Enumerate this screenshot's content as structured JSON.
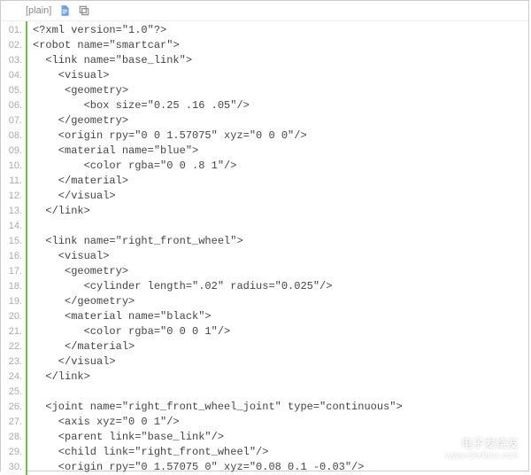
{
  "header": {
    "label": "[plain]",
    "icon1": "document-icon",
    "icon2": "copy-icon"
  },
  "lines": [
    {
      "n": "01.",
      "text": "<?xml version=\"1.0\"?>"
    },
    {
      "n": "02.",
      "text": "<robot name=\"smartcar\">"
    },
    {
      "n": "03.",
      "text": "  <link name=\"base_link\">"
    },
    {
      "n": "04.",
      "text": "    <visual>"
    },
    {
      "n": "05.",
      "text": "     <geometry>"
    },
    {
      "n": "06.",
      "text": "        <box size=\"0.25 .16 .05\"/>"
    },
    {
      "n": "07.",
      "text": "    </geometry>"
    },
    {
      "n": "08.",
      "text": "    <origin rpy=\"0 0 1.57075\" xyz=\"0 0 0\"/>"
    },
    {
      "n": "09.",
      "text": "    <material name=\"blue\">"
    },
    {
      "n": "10.",
      "text": "        <color rgba=\"0 0 .8 1\"/>"
    },
    {
      "n": "11.",
      "text": "    </material>"
    },
    {
      "n": "12.",
      "text": "    </visual>"
    },
    {
      "n": "13.",
      "text": "  </link>"
    },
    {
      "n": "14.",
      "text": ""
    },
    {
      "n": "15.",
      "text": "  <link name=\"right_front_wheel\">"
    },
    {
      "n": "16.",
      "text": "    <visual>"
    },
    {
      "n": "17.",
      "text": "     <geometry>"
    },
    {
      "n": "18.",
      "text": "        <cylinder length=\".02\" radius=\"0.025\"/>"
    },
    {
      "n": "19.",
      "text": "     </geometry>"
    },
    {
      "n": "20.",
      "text": "     <material name=\"black\">"
    },
    {
      "n": "21.",
      "text": "        <color rgba=\"0 0 0 1\"/>"
    },
    {
      "n": "22.",
      "text": "     </material>"
    },
    {
      "n": "23.",
      "text": "    </visual>"
    },
    {
      "n": "24.",
      "text": "  </link>"
    },
    {
      "n": "25.",
      "text": ""
    },
    {
      "n": "26.",
      "text": "  <joint name=\"right_front_wheel_joint\" type=\"continuous\">"
    },
    {
      "n": "27.",
      "text": "    <axis xyz=\"0 0 1\"/>"
    },
    {
      "n": "28.",
      "text": "    <parent link=\"base_link\"/>"
    },
    {
      "n": "29.",
      "text": "    <child link=\"right_front_wheel\"/>"
    },
    {
      "n": "30.",
      "text": "    <origin rpy=\"0 1.57075 0\" xyz=\"0.08 0.1 -0.03\"/>"
    }
  ],
  "watermark": {
    "brand": "电子发烧友",
    "url": "www.elecfans.com"
  }
}
